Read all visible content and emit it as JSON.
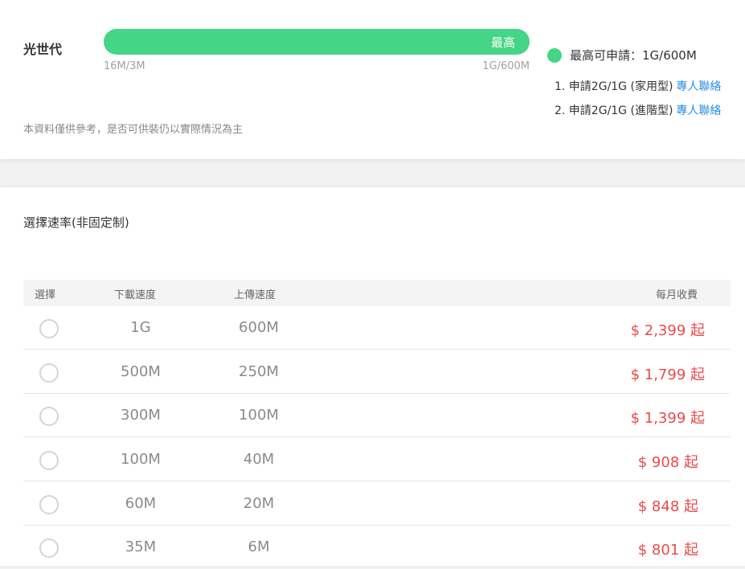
{
  "provider": "光世代",
  "speed_bar": {
    "label": "最高",
    "min_label": "16M/3M",
    "max_label": "1G/600M",
    "fill": 1.0,
    "color": "#44d586"
  },
  "disclaimer": "本資料僅供參考，是否可供裝仍以實際情況為主",
  "legend": {
    "text": "最高可申請：1G/600M",
    "color": "#44d586"
  },
  "plans": [
    {
      "text": "1. 申請2G/1G (家用型)",
      "link": "專人聯絡"
    },
    {
      "text": "2. 申請2G/1G (進階型)",
      "link": "專人聯絡"
    }
  ],
  "section_title": "選擇速率(非固定制)",
  "table": {
    "headers": {
      "select": "選擇",
      "download": "下載速度",
      "upload": "上傳速度",
      "price": "每月收費"
    },
    "rows": [
      {
        "download": "1G",
        "upload": "600M",
        "price": "$ 2,399 起"
      },
      {
        "download": "500M",
        "upload": "250M",
        "price": "$ 1,799 起"
      },
      {
        "download": "300M",
        "upload": "100M",
        "price": "$ 1,399 起"
      },
      {
        "download": "100M",
        "upload": "40M",
        "price": "$ 908 起"
      },
      {
        "download": "60M",
        "upload": "20M",
        "price": "$ 848 起"
      },
      {
        "download": "35M",
        "upload": "6M",
        "price": "$ 801 起"
      }
    ]
  },
  "colors": {
    "accent": "#44d586",
    "price": "#ea4a4a",
    "link": "#2b8ee0"
  }
}
